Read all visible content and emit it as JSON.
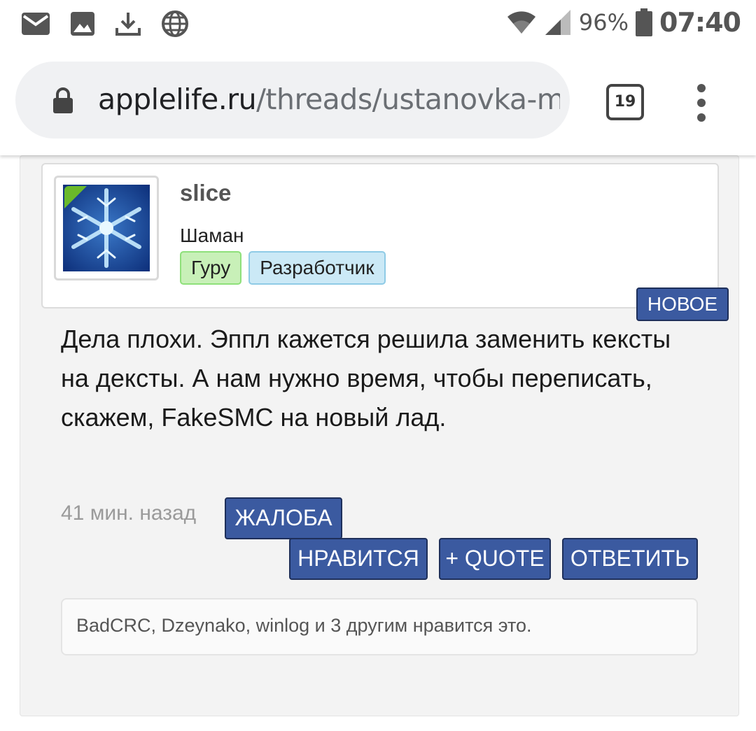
{
  "status_bar": {
    "battery_percent": "96%",
    "time": "07:40",
    "icons": [
      "mail-icon",
      "image-icon",
      "download-icon",
      "globe-icon",
      "wifi-icon",
      "signal-icon",
      "battery-icon"
    ]
  },
  "browser": {
    "url_domain": "applelife.ru",
    "url_path": "/threads/ustanovka-m",
    "tab_count": "19"
  },
  "post": {
    "username": "slice",
    "user_title": "Шаман",
    "badges": [
      "Гуру",
      "Разработчик"
    ],
    "new_label": "НОВОЕ",
    "message": "Дела плохи. Эппл кажется решила заменить кексты на дексты. А нам нужно время, чтобы переписать, скажем, FakeSMC на новый лад.",
    "time_ago": "41 мин. назад",
    "buttons": {
      "complaint": "ЖАЛОБА",
      "like": "НРАВИТСЯ",
      "quote": "+ QUOTE",
      "reply": "ОТВЕТИТЬ"
    },
    "likes_summary": "BadCRC, Dzeynako, winlog и 3 другим нравится это."
  },
  "colors": {
    "button_bg": "#3b5aa0",
    "online_indicator": "#6ab92a",
    "guru_badge": "#c8f0b8",
    "dev_badge": "#cbe9f6"
  }
}
